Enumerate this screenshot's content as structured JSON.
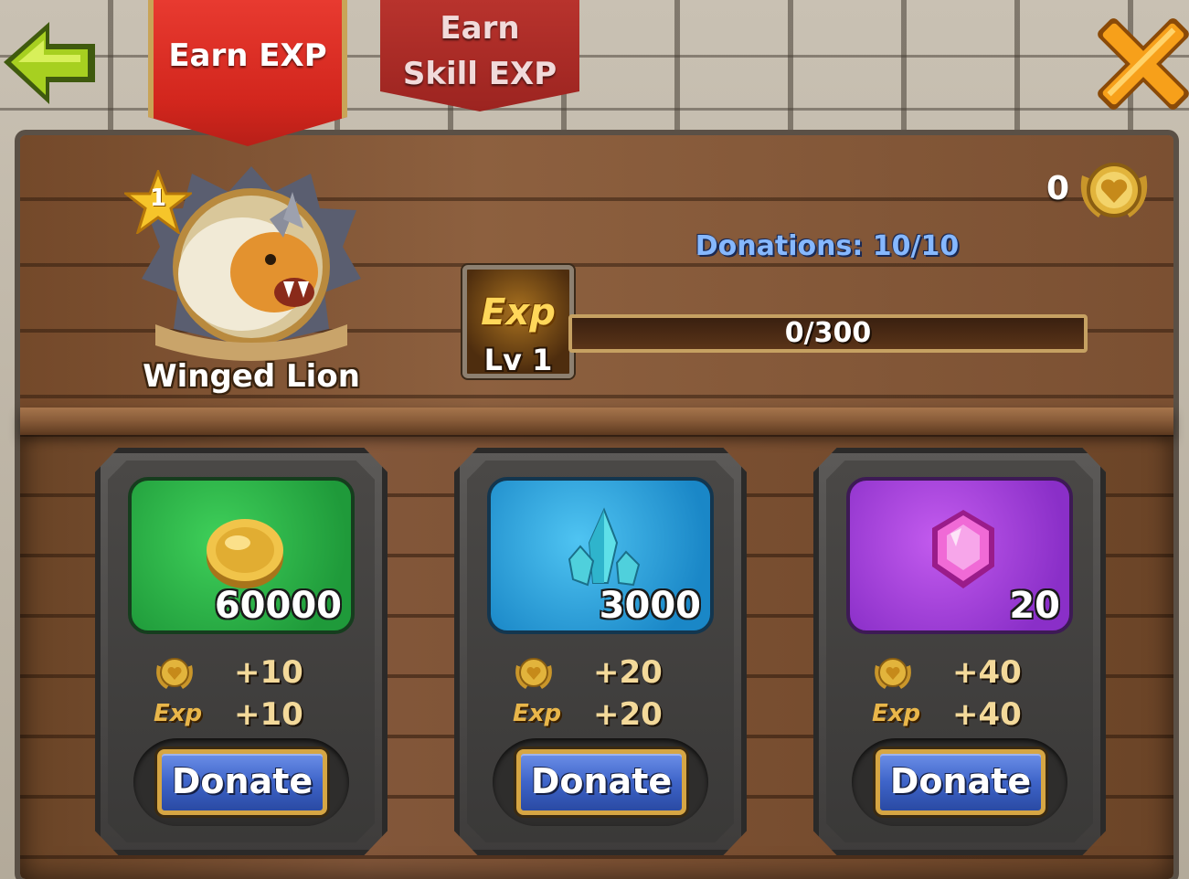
{
  "tabs": [
    {
      "label": "Earn EXP",
      "active": true
    },
    {
      "label": "Earn Skill EXP",
      "active": false
    }
  ],
  "hero": {
    "name": "Winged Lion",
    "stars": "1"
  },
  "medals": {
    "count": "0",
    "icon": "heart-medal-icon"
  },
  "donations_text": "Donations: 10/10",
  "exp": {
    "icon_label": "Exp",
    "level": "Lv 1",
    "progress_text": "0/300",
    "progress_fraction": 0
  },
  "cards": [
    {
      "resource": "gold",
      "icon": "gold-coin-icon",
      "amount": "60000",
      "medal_reward": "+10",
      "exp_label": "Exp",
      "exp_reward": "+10",
      "button": "Donate",
      "color": "#2fb34a"
    },
    {
      "resource": "shards",
      "icon": "crystal-shard-icon",
      "amount": "3000",
      "medal_reward": "+20",
      "exp_label": "Exp",
      "exp_reward": "+20",
      "button": "Donate",
      "color": "#2aa2dd"
    },
    {
      "resource": "gems",
      "icon": "gem-icon",
      "amount": "20",
      "medal_reward": "+40",
      "exp_label": "Exp",
      "exp_reward": "+40",
      "button": "Donate",
      "color": "#a842dc"
    }
  ],
  "colors": {
    "tab_active": "#d9281f",
    "donations_text": "#86b8ff",
    "button_blue": "#3e64c9",
    "button_border": "#d6a644"
  }
}
